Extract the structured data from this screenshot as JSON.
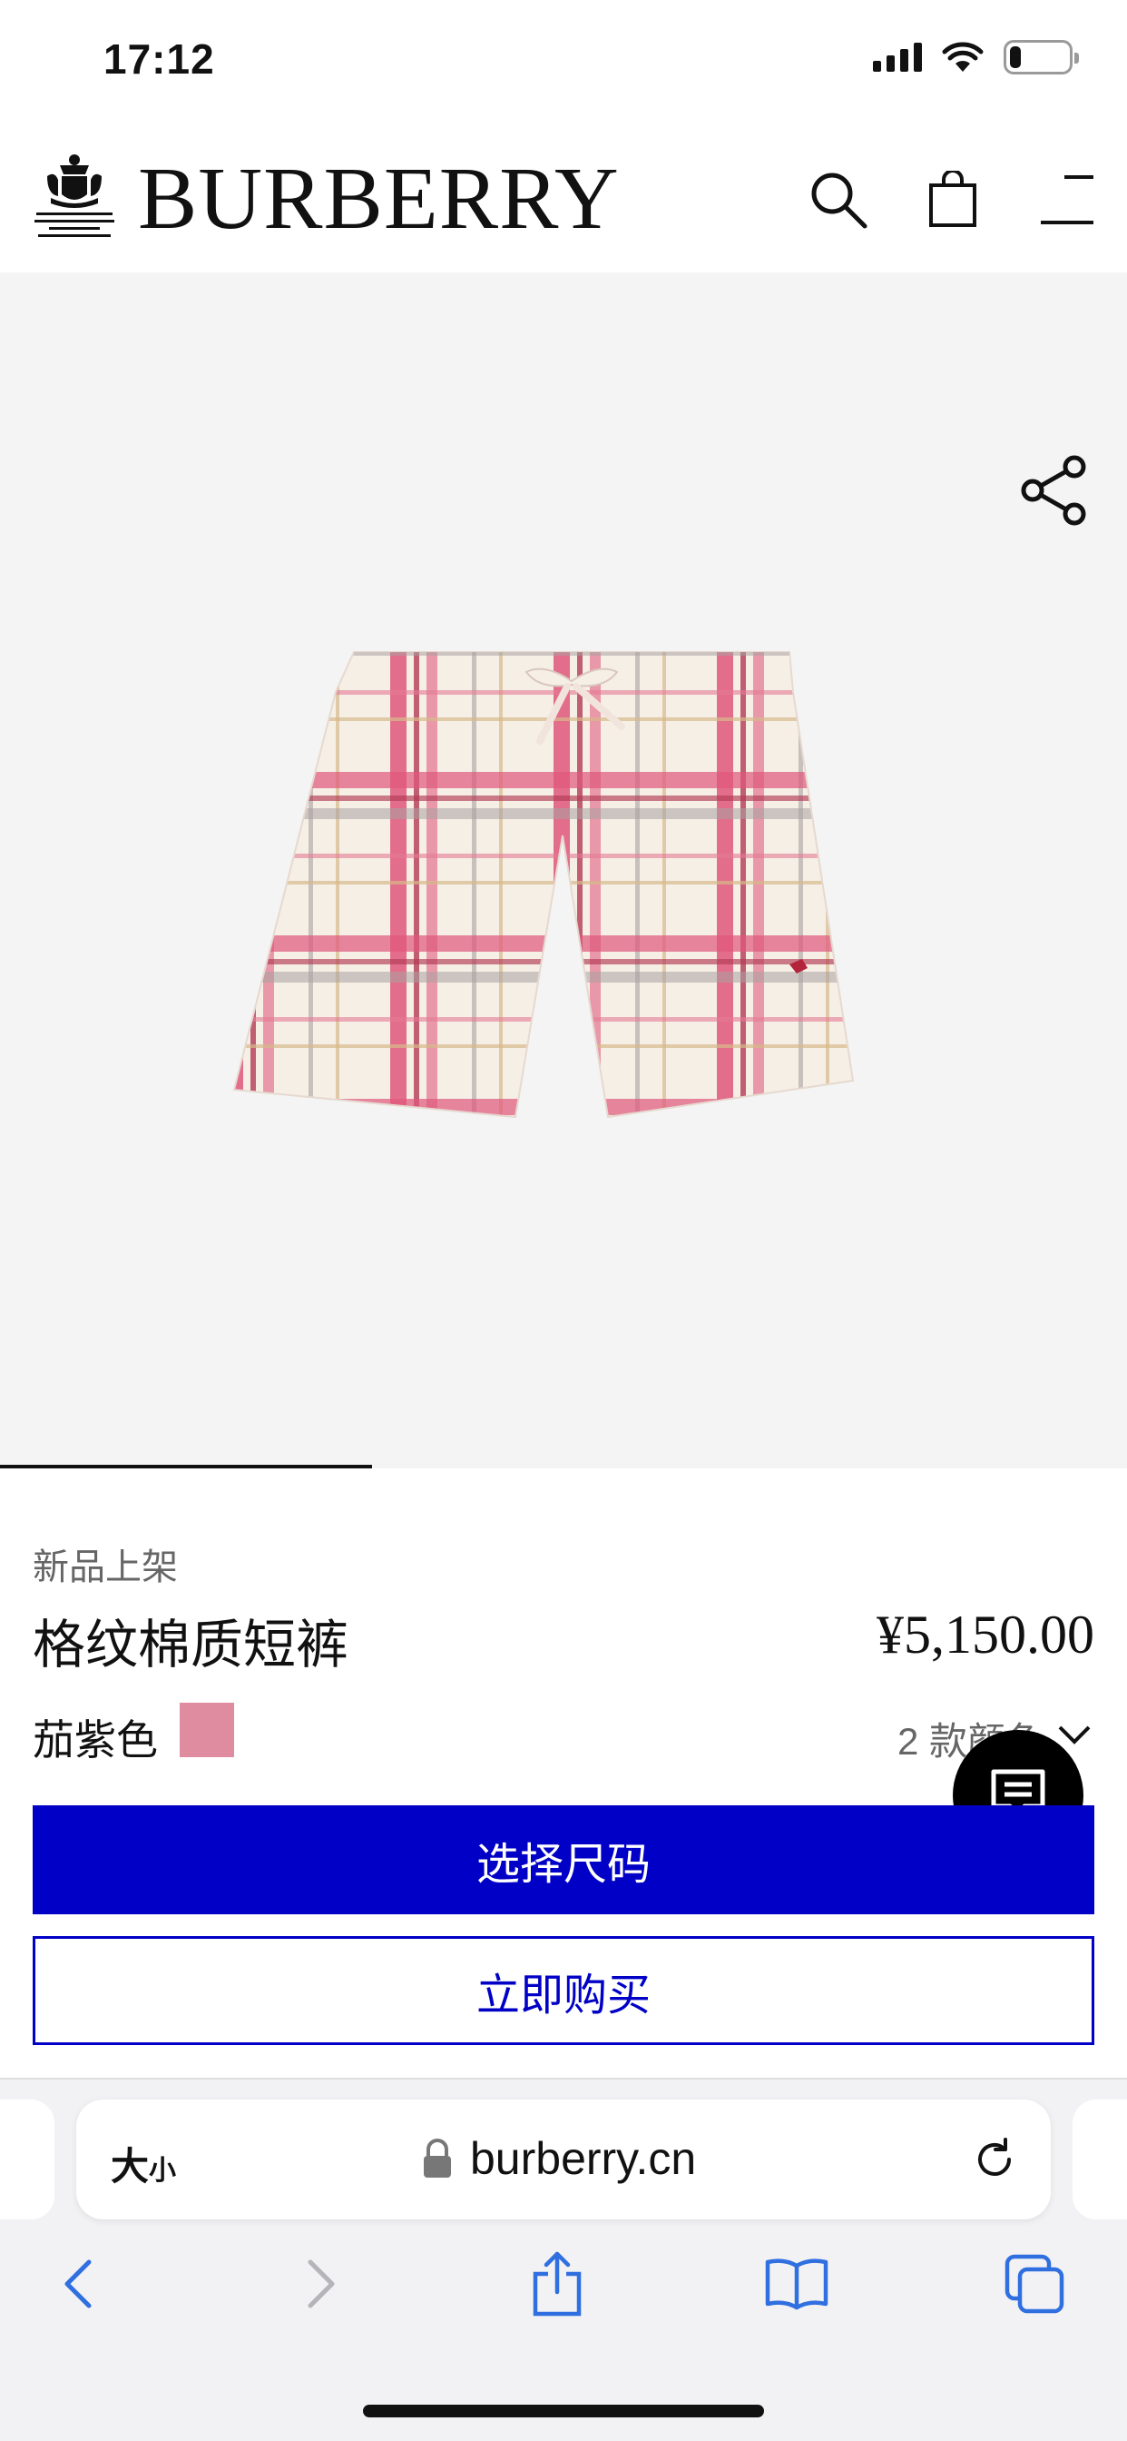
{
  "status_bar": {
    "time": "17:12",
    "battery_level": 0.2
  },
  "header": {
    "brand": "BURBERRY"
  },
  "product": {
    "tag": "新品上架",
    "name": "格纹棉质短裤",
    "price": "¥5,150.00",
    "color_name": "茄紫色",
    "swatch_color": "#e08ca0",
    "colors_count": "2 款颜色"
  },
  "actions": {
    "select_size": "选择尺码",
    "buy_now": "立即购买"
  },
  "browser": {
    "text_size_big": "大",
    "text_size_small": "小",
    "url": "burberry.cn"
  },
  "colors": {
    "accent": "#0000c6",
    "image_bg": "#f4f4f4"
  }
}
